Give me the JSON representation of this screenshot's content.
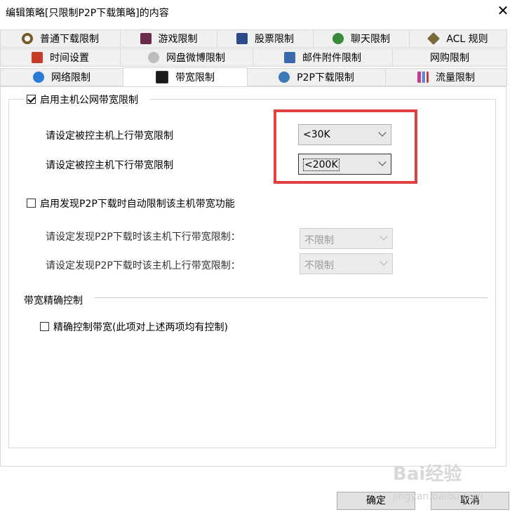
{
  "window": {
    "title": "编辑策略[只限制P2P下载策略]的内容",
    "close_label": "✕"
  },
  "tabs": {
    "row1": [
      {
        "label": "普通下载限制",
        "icon": "clock-icon",
        "color": "#7a5a2a"
      },
      {
        "label": "游戏限制",
        "icon": "game-icon",
        "color": "#6a2a4a"
      },
      {
        "label": "股票限制",
        "icon": "chart-icon",
        "color": "#2a4a8a"
      },
      {
        "label": "聊天限制",
        "icon": "chat-icon",
        "color": "#3a8a3a"
      },
      {
        "label": "ACL 规则",
        "icon": "tag-icon",
        "color": "#7a6a3a"
      }
    ],
    "row2": [
      {
        "label": "时间设置",
        "icon": "timer-icon",
        "color": "#c83a2a"
      },
      {
        "label": "网盘微博限制",
        "icon": "cloud-icon",
        "color": "#9a9a9a"
      },
      {
        "label": "邮件附件限制",
        "icon": "mail-icon",
        "color": "#3a6aaa"
      },
      {
        "label": "网购限制",
        "icon": "",
        "color": ""
      }
    ],
    "row3": [
      {
        "label": "网络限制",
        "icon": "ie-icon",
        "color": "#2a7ad8"
      },
      {
        "label": "带宽限制",
        "icon": "monitor-icon",
        "color": "#1a1a1a"
      },
      {
        "label": "P2P下载限制",
        "icon": "p2p-icon",
        "color": "#3a7ab8"
      },
      {
        "label": "流量限制",
        "icon": "bars-icon",
        "color": "#c83a8a"
      }
    ]
  },
  "bandwidth": {
    "enable_label": "启用主机公网带宽限制",
    "enable_checked": true,
    "upload_label": "请设定被控主机上行带宽限制",
    "upload_value": "<30K",
    "download_label": "请设定被控主机下行带宽限制",
    "download_value": "<200K"
  },
  "p2p": {
    "enable_label": "启用发现P2P下载时自动限制该主机带宽功能",
    "enable_checked": false,
    "download_label": "请设定发现P2P下载时该主机下行带宽限制：",
    "download_value": "不限制",
    "upload_label": "请设定发现P2P下载时该主机上行带宽限制：",
    "upload_value": "不限制"
  },
  "precise": {
    "section_label": "带宽精确控制",
    "checkbox_label": "精确控制带宽(此项对上述两项均有控制)",
    "checked": false
  },
  "buttons": {
    "ok": "确定",
    "cancel": "取消"
  },
  "watermark": {
    "brand": "Bai经验",
    "url": "jingyan.baidu.com"
  },
  "colors": {
    "highlight": "#e04040"
  }
}
